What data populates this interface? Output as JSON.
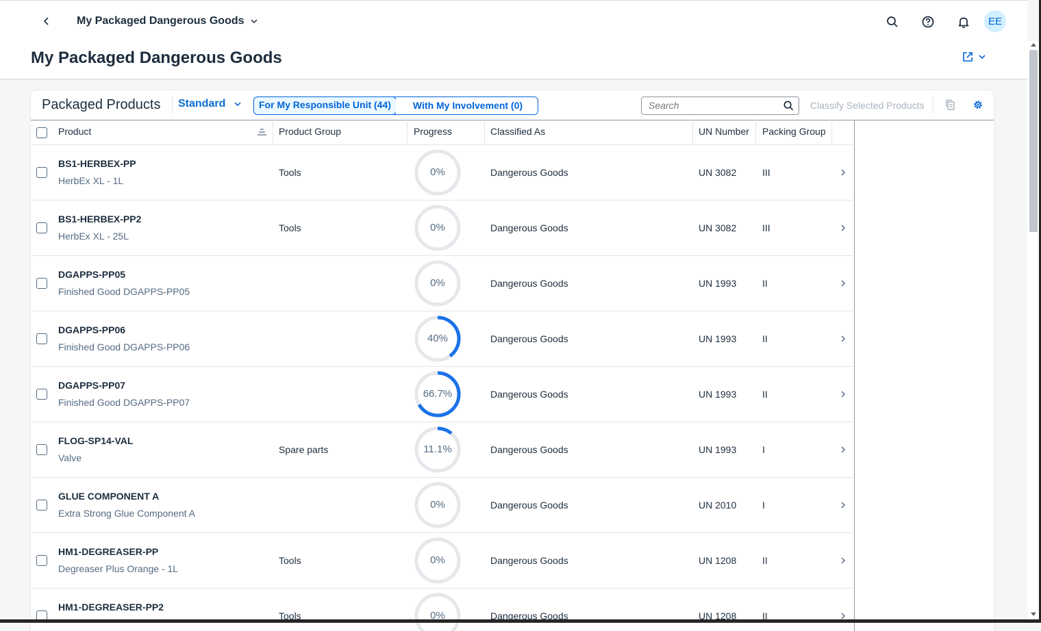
{
  "shell": {
    "app_title": "My Packaged Dangerous Goods",
    "avatar_initials": "EE"
  },
  "page": {
    "title": "My Packaged Dangerous Goods"
  },
  "toolbar": {
    "title": "Packaged Products",
    "variant": "Standard",
    "segment_responsible": "For My Responsible Unit (44)",
    "segment_involvement": "With My Involvement (0)",
    "search_placeholder": "Search",
    "classify_label": "Classify Selected Products"
  },
  "table": {
    "columns": {
      "product": "Product",
      "product_group": "Product Group",
      "progress": "Progress",
      "classified_as": "Classified As",
      "un_number": "UN Number",
      "packing_group": "Packing Group"
    },
    "rows": [
      {
        "name": "BS1-HERBEX-PP",
        "desc": "HerbEx XL - 1L",
        "group": "Tools",
        "progress": 0,
        "progress_label": "0%",
        "classified": "Dangerous Goods",
        "un": "UN 3082",
        "packing": "III"
      },
      {
        "name": "BS1-HERBEX-PP2",
        "desc": "HerbEx XL - 25L",
        "group": "Tools",
        "progress": 0,
        "progress_label": "0%",
        "classified": "Dangerous Goods",
        "un": "UN 3082",
        "packing": "III"
      },
      {
        "name": "DGAPPS-PP05",
        "desc": "Finished Good DGAPPS-PP05",
        "group": "",
        "progress": 0,
        "progress_label": "0%",
        "classified": "Dangerous Goods",
        "un": "UN 1993",
        "packing": "II"
      },
      {
        "name": "DGAPPS-PP06",
        "desc": "Finished Good DGAPPS-PP06",
        "group": "",
        "progress": 40,
        "progress_label": "40%",
        "classified": "Dangerous Goods",
        "un": "UN 1993",
        "packing": "II"
      },
      {
        "name": "DGAPPS-PP07",
        "desc": "Finished Good DGAPPS-PP07",
        "group": "",
        "progress": 66.7,
        "progress_label": "66.7%",
        "classified": "Dangerous Goods",
        "un": "UN 1993",
        "packing": "II"
      },
      {
        "name": "FLOG-SP14-VAL",
        "desc": "Valve",
        "group": "Spare parts",
        "progress": 11.1,
        "progress_label": "11.1%",
        "classified": "Dangerous Goods",
        "un": "UN 1993",
        "packing": "I"
      },
      {
        "name": "GLUE COMPONENT A",
        "desc": "Extra Strong Glue Component A",
        "group": "",
        "progress": 0,
        "progress_label": "0%",
        "classified": "Dangerous Goods",
        "un": "UN 2010",
        "packing": "I"
      },
      {
        "name": "HM1-DEGREASER-PP",
        "desc": "Degreaser Plus Orange - 1L",
        "group": "Tools",
        "progress": 0,
        "progress_label": "0%",
        "classified": "Dangerous Goods",
        "un": "UN 1208",
        "packing": "II"
      },
      {
        "name": "HM1-DEGREASER-PP2",
        "desc": "",
        "group": "Tools",
        "progress": 0,
        "progress_label": "0%",
        "classified": "Dangerous Goods",
        "un": "UN 1208",
        "packing": "II"
      }
    ]
  },
  "colors": {
    "accent": "#0064d9",
    "progress_fill": "#1b72e8",
    "progress_track": "#e5e8eb"
  }
}
